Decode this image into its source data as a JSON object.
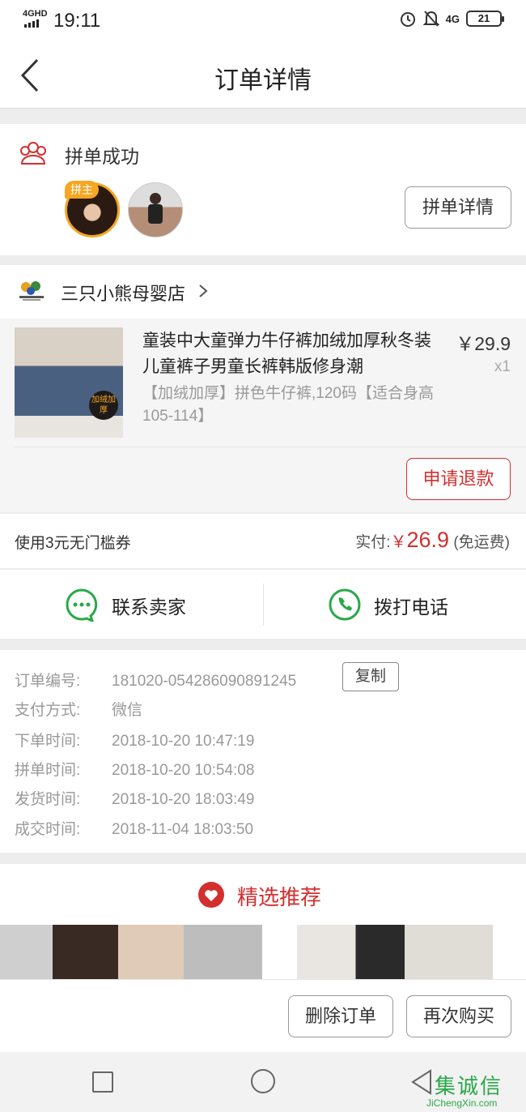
{
  "status_bar": {
    "network": "4GHD",
    "time": "19:11",
    "network_right": "4G",
    "battery": "21"
  },
  "header": {
    "title": "订单详情"
  },
  "group": {
    "status": "拼单成功",
    "host_badge": "拼主",
    "detail_button": "拼单详情"
  },
  "shop": {
    "name": "三只小熊母婴店",
    "product": {
      "title": "童装中大童弹力牛仔裤加绒加厚秋冬装儿童裤子男童长裤韩版修身潮",
      "spec": "【加绒加厚】拼色牛仔裤,120码【适合身高105-114】",
      "price": "￥29.9",
      "quantity": "x1",
      "image_tag": "加绒加厚"
    },
    "refund_button": "申请退款"
  },
  "payment": {
    "coupon": "使用3元无门槛券",
    "paid_label": "实付:",
    "currency": "￥",
    "paid_amount": "26.9",
    "shipping_note": "(免运费)"
  },
  "contact": {
    "seller_label": "联系卖家",
    "phone_label": "拨打电话"
  },
  "order_info": {
    "copy_button": "复制",
    "rows": [
      {
        "label": "订单编号:",
        "value": "181020-054286090891245"
      },
      {
        "label": "支付方式:",
        "value": "微信"
      },
      {
        "label": "下单时间:",
        "value": "2018-10-20 10:47:19"
      },
      {
        "label": "拼单时间:",
        "value": "2018-10-20 10:54:08"
      },
      {
        "label": "发货时间:",
        "value": "2018-10-20 18:03:49"
      },
      {
        "label": "成交时间:",
        "value": "2018-11-04 18:03:50"
      }
    ]
  },
  "recommend": {
    "title": "精选推荐"
  },
  "actions": {
    "delete_button": "删除订单",
    "rebuy_button": "再次购买"
  },
  "watermark": {
    "main": "集诚信",
    "url": "JiChengXin.com"
  },
  "colors": {
    "accent_red": "#d32f2f",
    "host_badge": "#f5a623",
    "contact_green": "#2aa84a"
  }
}
